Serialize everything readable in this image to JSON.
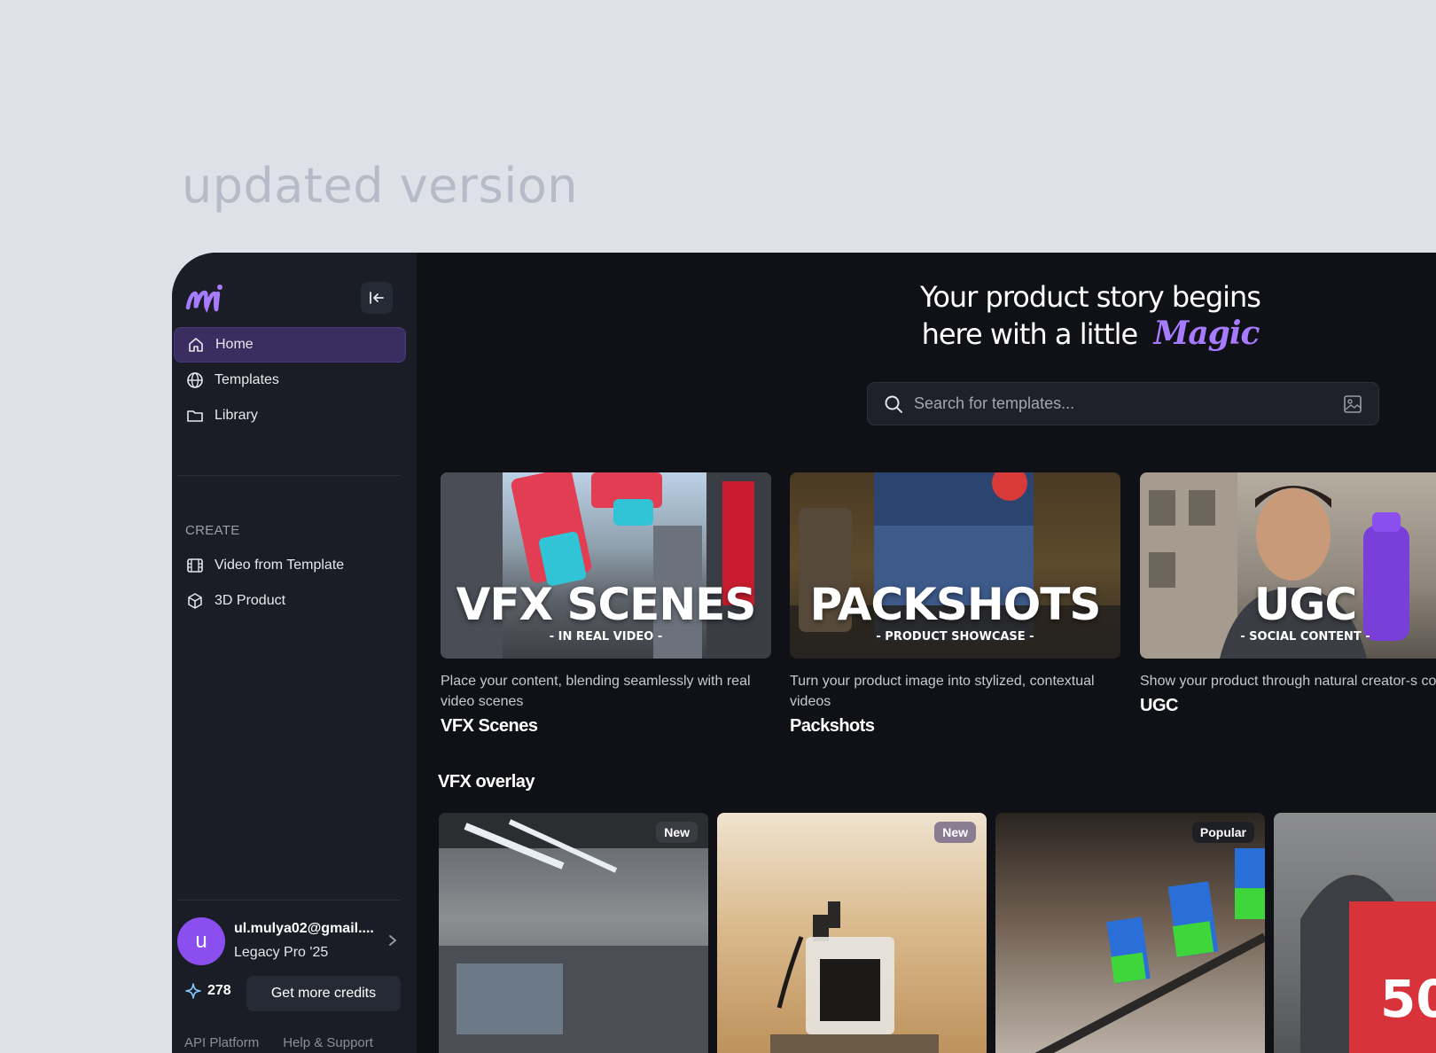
{
  "caption": "updated version",
  "sidebar": {
    "nav": [
      {
        "label": "Home"
      },
      {
        "label": "Templates"
      },
      {
        "label": "Library"
      }
    ],
    "create_label": "CREATE",
    "create_items": [
      {
        "label": "Video from Template"
      },
      {
        "label": "3D Product"
      }
    ],
    "user": {
      "initial": "u",
      "email": "ul.mulya02@gmail....",
      "plan": "Legacy Pro '25"
    },
    "credits": {
      "count": "278",
      "button": "Get more credits"
    },
    "footer": [
      "API Platform",
      "Help & Support"
    ]
  },
  "hero": {
    "line1": "Your product story begins",
    "line2": "here with a little",
    "magic": "Magic"
  },
  "search": {
    "placeholder": "Search for templates..."
  },
  "categories": [
    {
      "overlay_title": "VFX SCENES",
      "overlay_sub": "- IN REAL VIDEO -",
      "description": "Place your content, blending seamlessly with real video scenes",
      "name": "VFX Scenes"
    },
    {
      "overlay_title": "PACKSHOTS",
      "overlay_sub": "- PRODUCT SHOWCASE -",
      "description": "Turn your product image into stylized, contextual videos",
      "name": "Packshots"
    },
    {
      "overlay_title": "UGC",
      "overlay_sub": "- SOCIAL CONTENT -",
      "description": "Show your product through natural creator-s content",
      "name": "UGC"
    }
  ],
  "vfx_overlay": {
    "heading": "VFX overlay",
    "cards": [
      {
        "badge": "New"
      },
      {
        "badge": "New"
      },
      {
        "badge": "Popular"
      },
      {
        "badge": ""
      }
    ]
  },
  "colors": {
    "accent": "#a77bff",
    "active_nav": "#3a2d5f",
    "avatar": "#8b4ff0"
  }
}
